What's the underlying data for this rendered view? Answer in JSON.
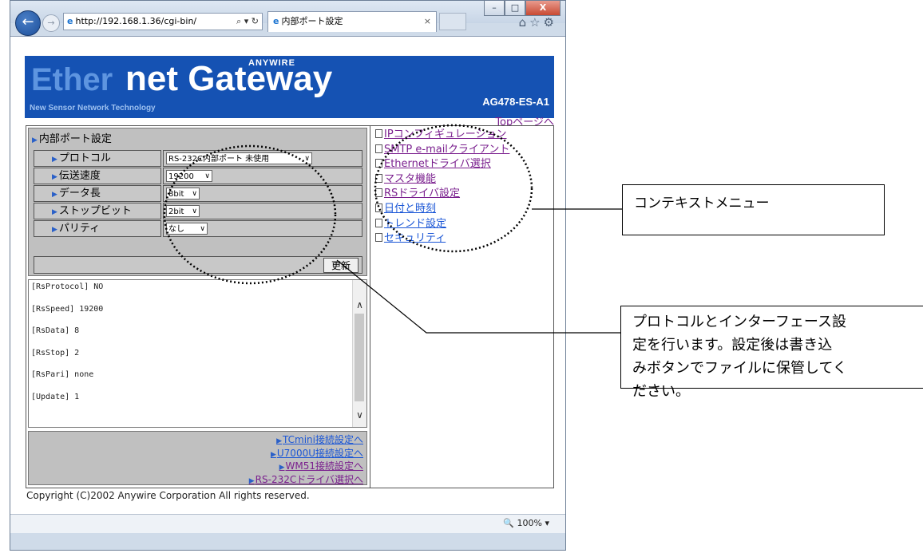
{
  "browser": {
    "address": "http://192.168.1.36/cgi-bin/",
    "address_controls": "⌕ ▾ ↻",
    "tab_title": "内部ポート設定",
    "tab_close": "×",
    "zoom": "100%",
    "window_buttons": {
      "minimize": "–",
      "maximize": "□",
      "close": "X"
    }
  },
  "banner": {
    "ether": "Ether",
    "net_gateway": "net Gateway",
    "anywire": "ANYWIRE",
    "subtitle": "New Sensor Network Technology",
    "model": "AG478-ES-A1"
  },
  "top_link": "Topページへ",
  "settings_panel": {
    "title": "内部ポート設定",
    "rows": [
      {
        "label": "プロトコル",
        "value": "RS-232C内部ポート 未使用"
      },
      {
        "label": "伝送速度",
        "value": "19200"
      },
      {
        "label": "データ長",
        "value": "8bit"
      },
      {
        "label": "ストップビット",
        "value": "2bit"
      },
      {
        "label": "パリティ",
        "value": "なし"
      }
    ],
    "update_button": "更新"
  },
  "output_lines": [
    "[RsProtocol] NO",
    "[RsSpeed] 19200",
    "[RsData] 8",
    "[RsStop] 2",
    "[RsPari] none",
    "[Update] 1"
  ],
  "bottom_links": [
    {
      "label": "TCmini接続設定へ",
      "color": "#1a56d6"
    },
    {
      "label": "U7000U接続設定へ",
      "color": "#1a56d6"
    },
    {
      "label": "WM51接続設定へ",
      "color": "#7a1f8e"
    },
    {
      "label": "RS-232Cドライバ選択へ",
      "color": "#7a1f8e"
    }
  ],
  "context_menu": [
    {
      "label": "IPコンフィギュレーション",
      "color": "#7a1f8e"
    },
    {
      "label": "SMTP e-mailクライアント",
      "color": "#7a1f8e"
    },
    {
      "label": "Ethernetドライバ選択",
      "color": "#7a1f8e"
    },
    {
      "label": "マスタ機能",
      "color": "#7a1f8e"
    },
    {
      "label": "RSドライバ設定",
      "color": "#7a1f8e"
    },
    {
      "label": "日付と時刻",
      "color": "#1a56d6"
    },
    {
      "label": "トレンド設定",
      "color": "#1a56d6"
    },
    {
      "label": "セキュリティ",
      "color": "#1a56d6"
    }
  ],
  "copyright": "Copyright (C)2002 Anywire Corporation All rights reserved.",
  "annotations": {
    "context_menu": "コンテキストメニュー",
    "protocol": [
      "プロトコルとインターフェース設",
      "定を行います。設定後は書き込",
      "みボタンでファイルに保管してく",
      "ださい。"
    ]
  }
}
